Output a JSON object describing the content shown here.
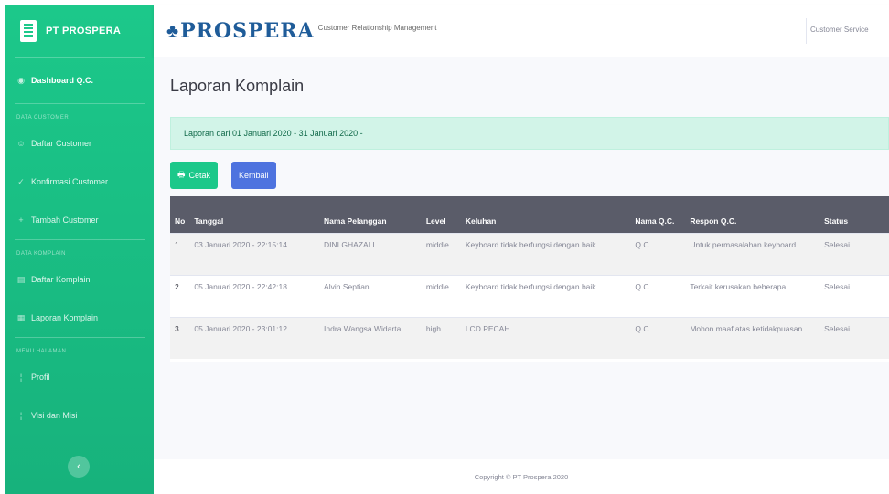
{
  "sidebar": {
    "brand": "PT PROSPERA",
    "dashboard": "Dashboard Q.C.",
    "heading_customer": "DATA CUSTOMER",
    "daftar_customer": "Daftar Customer",
    "konfirmasi_customer": "Konfirmasi Customer",
    "tambah_customer": "Tambah Customer",
    "heading_komplain": "DATA KOMPLAIN",
    "daftar_komplain": "Daftar Komplain",
    "laporan_komplain": "Laporan Komplain",
    "heading_menu": "MENU HALAMAN",
    "profil": "Profil",
    "visi_misi": "Visi dan Misi"
  },
  "topbar": {
    "logo": "PROSPERA",
    "subtitle": "Customer Relationship Management",
    "user": "Customer Service"
  },
  "main": {
    "title": "Laporan Komplain",
    "alert": "Laporan dari 01 Januari 2020 - 31 Januari 2020 -",
    "cetak_label": "Cetak",
    "kembali_label": "Kembali"
  },
  "table": {
    "headers": {
      "no": "No",
      "tanggal": "Tanggal",
      "nama": "Nama Pelanggan",
      "level": "Level",
      "keluhan": "Keluhan",
      "nama_qc": "Nama Q.C.",
      "respon": "Respon Q.C.",
      "status": "Status"
    },
    "rows": [
      {
        "no": "1",
        "tanggal": "03 Januari 2020 - 22:15:14",
        "nama": "DINI GHAZALI",
        "level": "middle",
        "keluhan": "Keyboard tidak berfungsi dengan baik",
        "qc": "Q.C",
        "respon": "Untuk permasalahan keyboard...",
        "status": "Selesai"
      },
      {
        "no": "2",
        "tanggal": "05 Januari 2020 - 22:42:18",
        "nama": "Alvin Septian",
        "level": "middle",
        "keluhan": "Keyboard tidak berfungsi dengan baik",
        "qc": "Q.C",
        "respon": "Terkait kerusakan beberapa...",
        "status": "Selesai"
      },
      {
        "no": "3",
        "tanggal": "05 Januari 2020 - 23:01:12",
        "nama": "Indra Wangsa Widarta",
        "level": "high",
        "keluhan": "LCD PECAH",
        "qc": "Q.C",
        "respon": "Mohon maaf atas ketidakpuasan...",
        "status": "Selesai"
      }
    ]
  },
  "footer": {
    "copyright": "Copyright © PT Prospera 2020"
  },
  "colors": {
    "sidebar": "#1cc88a",
    "primary": "#4e73df",
    "table_head": "#5a5c69",
    "logo": "#1f5c99"
  }
}
